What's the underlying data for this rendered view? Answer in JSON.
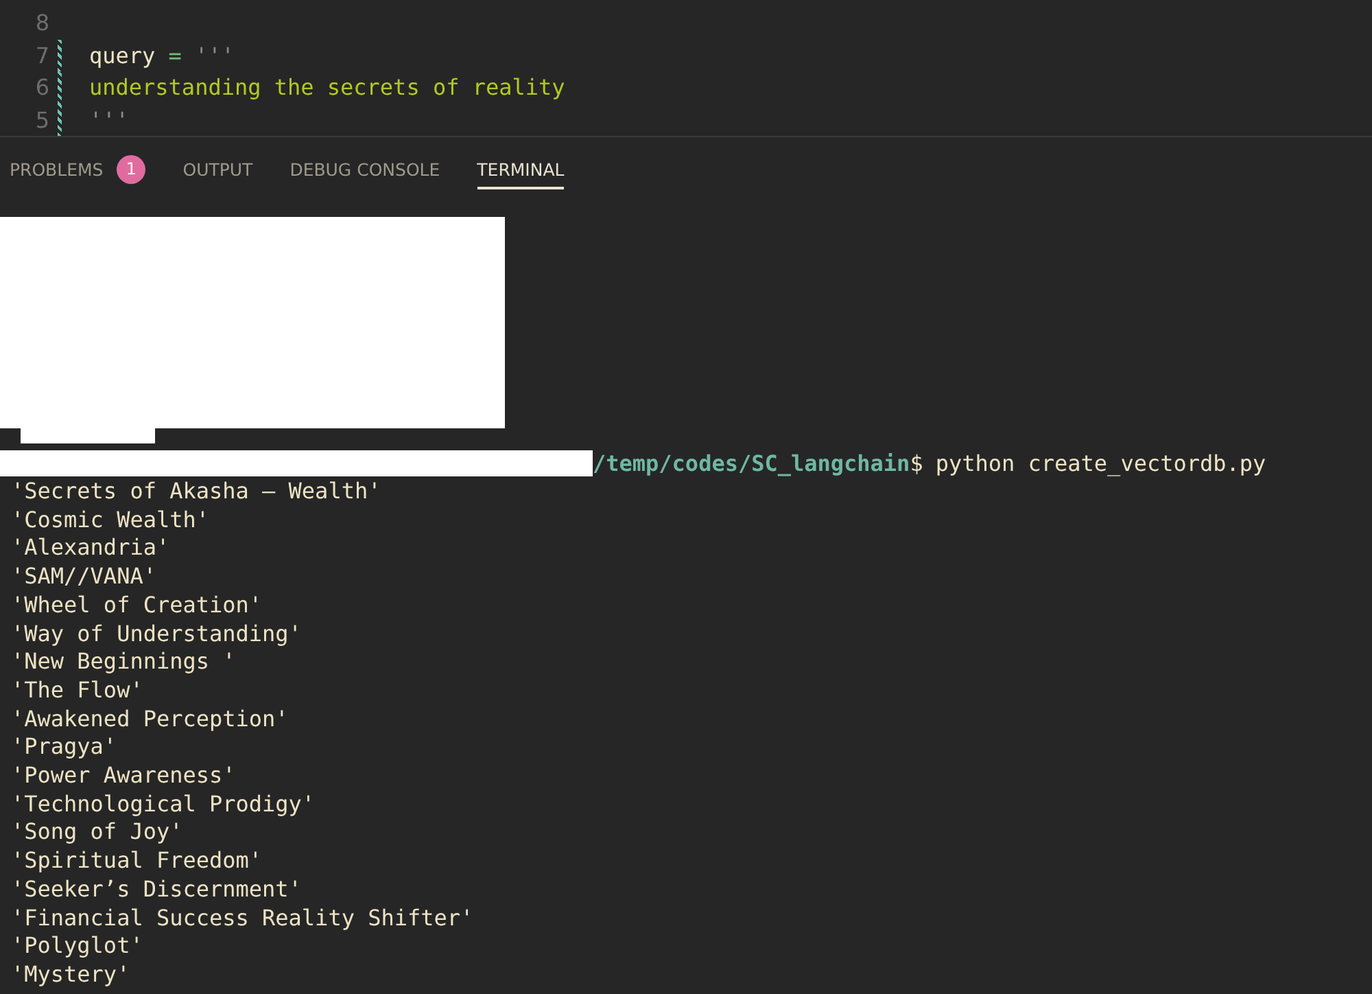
{
  "editor": {
    "lines": [
      {
        "number": "8",
        "modified": false
      },
      {
        "number": "7",
        "modified": true,
        "tokens": [
          {
            "text": "query",
            "kind": "name"
          },
          {
            "text": "=",
            "kind": "operator"
          },
          {
            "text": "'''",
            "kind": "quote"
          }
        ]
      },
      {
        "number": "6",
        "modified": true,
        "tokens": [
          {
            "text": "understanding the secrets of reality",
            "kind": "string"
          }
        ]
      },
      {
        "number": "5",
        "modified": true,
        "tokens": [
          {
            "text": "'''",
            "kind": "quote"
          }
        ]
      }
    ]
  },
  "panel_tabs": [
    {
      "label": "PROBLEMS",
      "badge": "1",
      "selected": false
    },
    {
      "label": "OUTPUT",
      "selected": false
    },
    {
      "label": "DEBUG CONSOLE",
      "selected": false
    },
    {
      "label": "TERMINAL",
      "selected": true
    }
  ],
  "terminal": {
    "prompt": {
      "path": "/temp/codes/SC_langchain",
      "symbol": "$",
      "command": "python create_vectordb.py"
    },
    "output": [
      "'Secrets of Akasha – Wealth'",
      "'Cosmic Wealth'",
      "'Alexandria'",
      "'SAM//VANA'",
      "'Wheel of Creation'",
      "'Way of Understanding'",
      "'New Beginnings '",
      "'The Flow'",
      "'Awakened Perception'",
      "'Pragya'",
      "'Power Awareness'",
      "'Technological Prodigy'",
      "'Song of Joy'",
      "'Spiritual Freedom'",
      "'Seeker’s Discernment'",
      "'Financial Success Reality Shifter'",
      "'Polyglot'",
      "'Mystery'"
    ]
  }
}
